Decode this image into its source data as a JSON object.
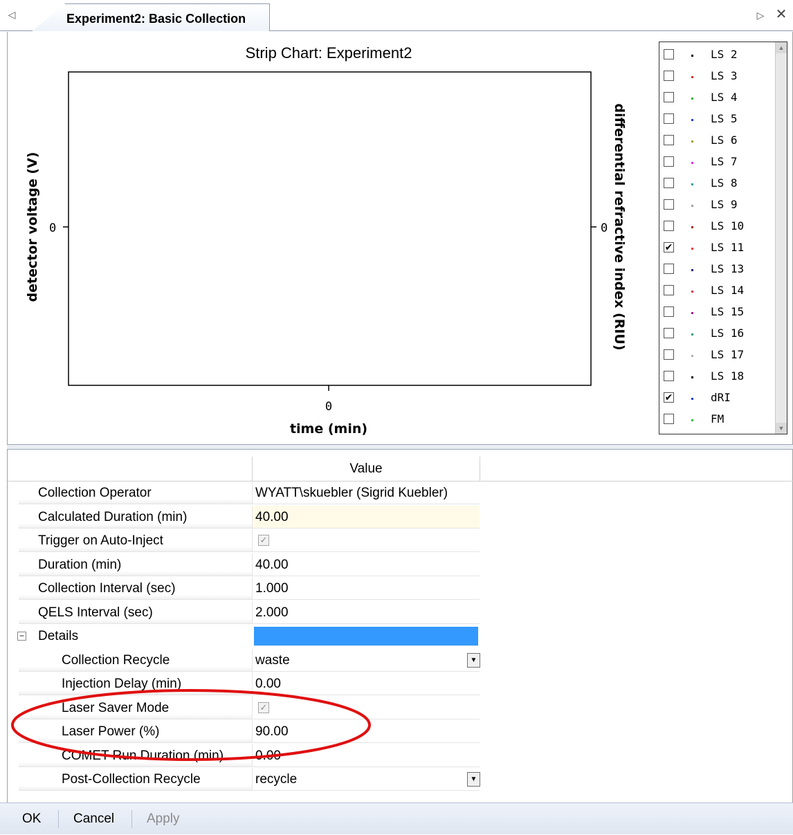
{
  "tab": {
    "title": "Experiment2: Basic Collection",
    "prev_icon": "◁",
    "next_icon": "▷",
    "close_icon": "✕"
  },
  "chart": {
    "title": "Strip Chart: Experiment2",
    "xlabel": "time (min)",
    "ylabel_left": "detector voltage (V)",
    "ylabel_right": "differential refractive index (RIU)",
    "x_tick": "0",
    "y_left_tick": "0",
    "y_right_tick": "0"
  },
  "chart_data": {
    "type": "line",
    "title": "Strip Chart: Experiment2",
    "xlabel": "time (min)",
    "ylabel": "detector voltage (V)",
    "y2label": "differential refractive index (RIU)",
    "x_ticks": [
      "0"
    ],
    "y_ticks": [
      "0"
    ],
    "y2_ticks": [
      "0"
    ],
    "series": [],
    "grid": false,
    "legend_position": "right"
  },
  "legend": {
    "items": [
      {
        "label": "LS 2",
        "checked": false,
        "color": "#000000"
      },
      {
        "label": "LS 3",
        "checked": false,
        "color": "#e03030"
      },
      {
        "label": "LS 4",
        "checked": false,
        "color": "#30b030"
      },
      {
        "label": "LS 5",
        "checked": false,
        "color": "#2040d0"
      },
      {
        "label": "LS 6",
        "checked": false,
        "color": "#a0a020"
      },
      {
        "label": "LS 7",
        "checked": false,
        "color": "#e030e0"
      },
      {
        "label": "LS 8",
        "checked": false,
        "color": "#20a0a0"
      },
      {
        "label": "LS 9",
        "checked": false,
        "color": "#a0a0a0"
      },
      {
        "label": "LS 10",
        "checked": false,
        "color": "#a02020"
      },
      {
        "label": "LS 11",
        "checked": true,
        "color": "#ff3030"
      },
      {
        "label": "LS 13",
        "checked": false,
        "color": "#202080"
      },
      {
        "label": "LS 14",
        "checked": false,
        "color": "#e03050"
      },
      {
        "label": "LS 15",
        "checked": false,
        "color": "#a02080"
      },
      {
        "label": "LS 16",
        "checked": false,
        "color": "#20a080"
      },
      {
        "label": "LS 17",
        "checked": false,
        "color": "#b0b0b0"
      },
      {
        "label": "LS 18",
        "checked": false,
        "color": "#000000"
      },
      {
        "label": "dRI",
        "checked": true,
        "color": "#2040e0"
      },
      {
        "label": "FM",
        "checked": false,
        "color": "#30c030"
      }
    ],
    "check_mark": "✔"
  },
  "grid": {
    "header_value": "Value",
    "rows": [
      {
        "name": "Collection Operator",
        "value": "WYATT\\skuebler (Sigrid Kuebler)",
        "type": "text"
      },
      {
        "name": "Calculated Duration (min)",
        "value": "40.00",
        "type": "calc"
      },
      {
        "name": "Trigger on Auto-Inject",
        "value": "",
        "type": "check",
        "checked": true
      },
      {
        "name": "Duration (min)",
        "value": "40.00",
        "type": "text"
      },
      {
        "name": "Collection Interval (sec)",
        "value": "1.000",
        "type": "text"
      },
      {
        "name": "QELS Interval (sec)",
        "value": "2.000",
        "type": "text"
      }
    ],
    "details": {
      "label": "Details",
      "toggle": "⊟",
      "rows": [
        {
          "name": "Collection Recycle",
          "value": "waste",
          "type": "dropdown"
        },
        {
          "name": "Injection Delay (min)",
          "value": "0.00",
          "type": "text"
        },
        {
          "name": "Laser Saver Mode",
          "value": "",
          "type": "check",
          "checked": true
        },
        {
          "name": "Laser Power (%)",
          "value": "90.00",
          "type": "text"
        },
        {
          "name": "COMET Run Duration (min)",
          "value": "0.00",
          "type": "text"
        },
        {
          "name": "Post-Collection Recycle",
          "value": "recycle",
          "type": "dropdown"
        }
      ]
    },
    "dropdown_icon": "▼",
    "check_icon": "✓"
  },
  "buttons": {
    "ok": "OK",
    "cancel": "Cancel",
    "apply": "Apply"
  },
  "colors": {
    "annotation": "#e01010",
    "selected": "#3399ff",
    "calc_bg": "#fffbe8"
  }
}
